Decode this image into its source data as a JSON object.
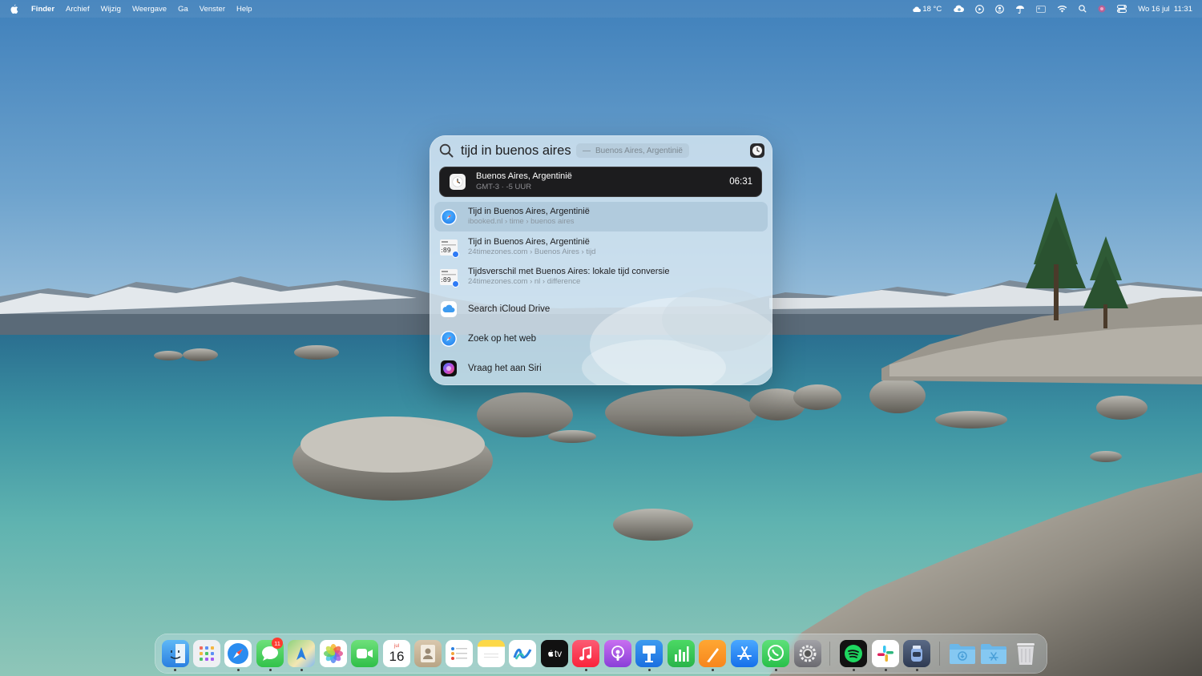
{
  "menubar": {
    "app_name": "Finder",
    "menus": [
      "Archief",
      "Wijzig",
      "Weergave",
      "Ga",
      "Venster",
      "Help"
    ],
    "weather": "18 °C",
    "datetime": "Wo 16 jul  11:31",
    "status_icons": [
      "creative-cloud-icon",
      "play-circle-icon",
      "user-circle-icon",
      "umbrella-icon",
      "card-icon",
      "wifi-icon",
      "search-icon",
      "siri-icon",
      "control-center-icon"
    ]
  },
  "spotlight": {
    "query": "tijd in buenos aires",
    "completion": "Buenos Aires, Argentinië",
    "completion_dash": "—",
    "clock_card": {
      "city": "Buenos Aires, Argentinië",
      "offset": "GMT-3 · -5 UUR",
      "time": "06:31"
    },
    "results": [
      {
        "title": "Tijd in Buenos Aires, Argentinië",
        "subtitle": "ibooked.nl › time › buenos aires",
        "icon": "safari-icon",
        "selected": true
      },
      {
        "title": "Tijd in Buenos Aires, Argentinië",
        "subtitle": "24timezones.com › Buenos Aires › tijd",
        "icon": "website-thumbnail-icon"
      },
      {
        "title": "Tijdsverschil met Buenos Aires: lokale tijd conversie",
        "subtitle": "24timezones.com › nl › difference",
        "icon": "website-thumbnail-icon"
      }
    ],
    "actions": [
      {
        "label": "Search iCloud Drive",
        "icon": "icloud-icon"
      },
      {
        "label": "Zoek op het web",
        "icon": "safari-icon"
      },
      {
        "label": "Vraag het aan Siri",
        "icon": "siri-icon"
      }
    ]
  },
  "dock": {
    "apps": [
      "Finder",
      "Launchpad",
      "Safari",
      "Berichten",
      "Kaarten",
      "Foto's",
      "FaceTime",
      "Agenda",
      "Contacten",
      "Herinneringen",
      "Notities",
      "Freeform",
      "TV",
      "Muziek",
      "Podcasts",
      "Keynote",
      "Numbers",
      "Pages",
      "App Store",
      "WhatsApp",
      "Systeeminstellingen",
      "Spotify",
      "Slack",
      "Finder-app",
      "Downloads",
      "Programma's",
      "Prullenmand"
    ],
    "messages_badge": "11",
    "calendar_month": "jul",
    "calendar_day": "16",
    "tv_label": "tv"
  },
  "colors": {
    "accent": "#1871e8",
    "clock_card_bg": "#1c1c1e",
    "spotlight_bg": "#dae9f3"
  }
}
